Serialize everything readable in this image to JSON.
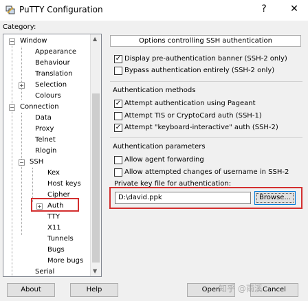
{
  "window": {
    "title": "PuTTY Configuration",
    "help_glyph": "?",
    "close_glyph": "✕"
  },
  "category_label": "Category:",
  "tree": {
    "expand_minus": "−",
    "expand_plus": "+",
    "items": [
      {
        "label": "Window"
      },
      {
        "label": "Appearance"
      },
      {
        "label": "Behaviour"
      },
      {
        "label": "Translation"
      },
      {
        "label": "Selection"
      },
      {
        "label": "Colours"
      },
      {
        "label": "Connection"
      },
      {
        "label": "Data"
      },
      {
        "label": "Proxy"
      },
      {
        "label": "Telnet"
      },
      {
        "label": "Rlogin"
      },
      {
        "label": "SSH"
      },
      {
        "label": "Kex"
      },
      {
        "label": "Host keys"
      },
      {
        "label": "Cipher"
      },
      {
        "label": "Auth"
      },
      {
        "label": "TTY"
      },
      {
        "label": "X11"
      },
      {
        "label": "Tunnels"
      },
      {
        "label": "Bugs"
      },
      {
        "label": "More bugs"
      },
      {
        "label": "Serial"
      }
    ],
    "scroll_up": "▲",
    "scroll_down": "▼"
  },
  "panel": {
    "header": "Options controlling SSH authentication",
    "banner_checkbox": {
      "label": "Display pre-authentication banner (SSH-2 only)",
      "checked": true
    },
    "bypass_checkbox": {
      "label": "Bypass authentication entirely (SSH-2 only)",
      "checked": false
    },
    "auth_methods_label": "Authentication methods",
    "pageant_checkbox": {
      "label": "Attempt authentication using Pageant",
      "checked": true
    },
    "tis_checkbox": {
      "label": "Attempt TIS or CryptoCard auth (SSH-1)",
      "checked": false
    },
    "ki_checkbox": {
      "label": "Attempt \"keyboard-interactive\" auth (SSH-2)",
      "checked": true
    },
    "auth_params_label": "Authentication parameters",
    "agent_fwd_checkbox": {
      "label": "Allow agent forwarding",
      "checked": false
    },
    "username_change_checkbox": {
      "label": "Allow attempted changes of username in SSH-2",
      "checked": false
    },
    "keyfile_label": "Private key file for authentication:",
    "keyfile_value": "D:\\david.ppk",
    "browse_label": "Browse...",
    "check_glyph": "✓"
  },
  "buttons": {
    "about": "About",
    "help": "Help",
    "open": "Open",
    "cancel": "Cancel"
  },
  "watermark": "知乎 @雨溪"
}
